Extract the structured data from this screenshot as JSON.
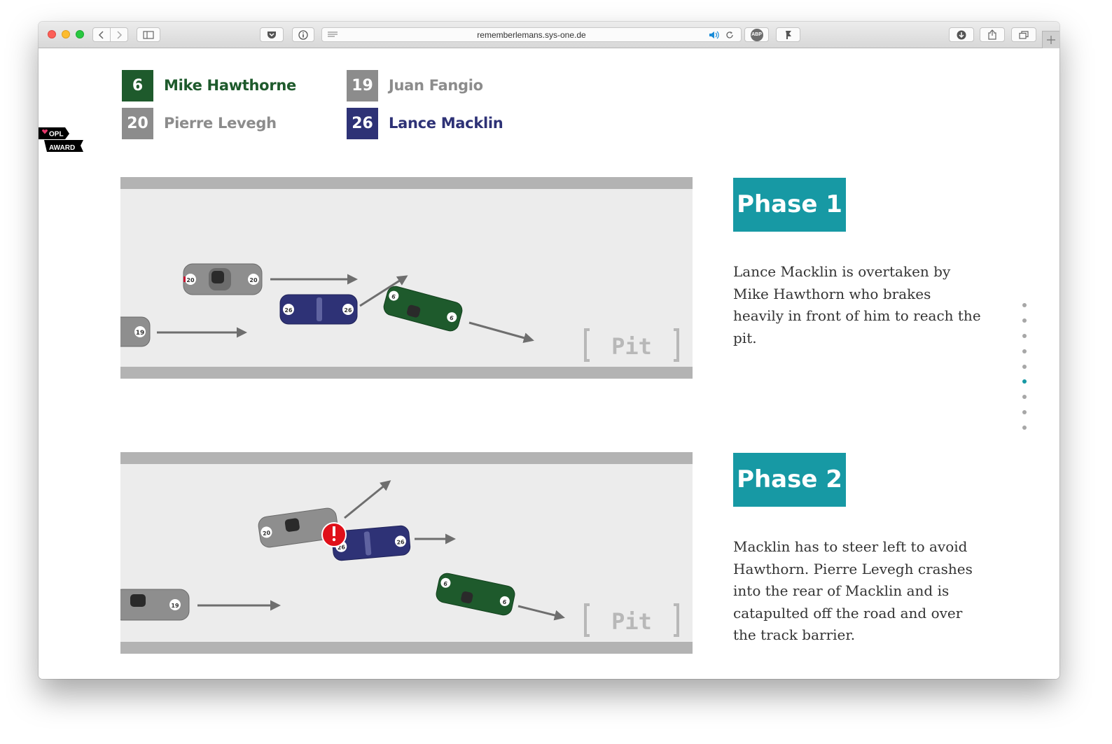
{
  "browser": {
    "url": "rememberlemans.sys-one.de",
    "icons": [
      "back-icon",
      "forward-icon",
      "sidebar-icon",
      "pocket-icon",
      "info-icon",
      "reader-icon",
      "audio-icon",
      "reload-icon",
      "adblock-icon",
      "extension-icon",
      "download-icon",
      "share-icon",
      "tabs-icon",
      "new-tab-icon"
    ],
    "adblock_label": "ABP"
  },
  "legend": [
    {
      "number": "6",
      "name": "Mike Hawthorne",
      "color": "#1e5a2c",
      "text_color": "#1e5a2c"
    },
    {
      "number": "19",
      "name": "Juan Fangio",
      "color": "#8c8c8c",
      "text_color": "#8c8c8c"
    },
    {
      "number": "20",
      "name": "Pierre Levegh",
      "color": "#8c8c8c",
      "text_color": "#8c8c8c"
    },
    {
      "number": "26",
      "name": "Lance Macklin",
      "color": "#2e3276",
      "text_color": "#2e3276"
    }
  ],
  "badge": {
    "line1": "OPL",
    "line2": "AWARD"
  },
  "phases": [
    {
      "title": "Phase 1",
      "text": "Lance Macklin is overtaken by Mike Hawthorn who brakes heavily in front of him to reach the pit.",
      "pit_label": "Pit"
    },
    {
      "title": "Phase 2",
      "text": "Macklin has to steer left to avoid Hawthorn. Pierre Levegh crashes into the rear of Macklin and is catapulted off the road and over the track barrier.",
      "pit_label": "Pit"
    }
  ],
  "dot_nav": {
    "count": 9,
    "active_index": 5
  },
  "colors": {
    "accent": "#1799a4",
    "hawthorn": "#1e5a2c",
    "macklin": "#2e3276",
    "grey": "#8c8c8c",
    "warning": "#e0101a"
  }
}
